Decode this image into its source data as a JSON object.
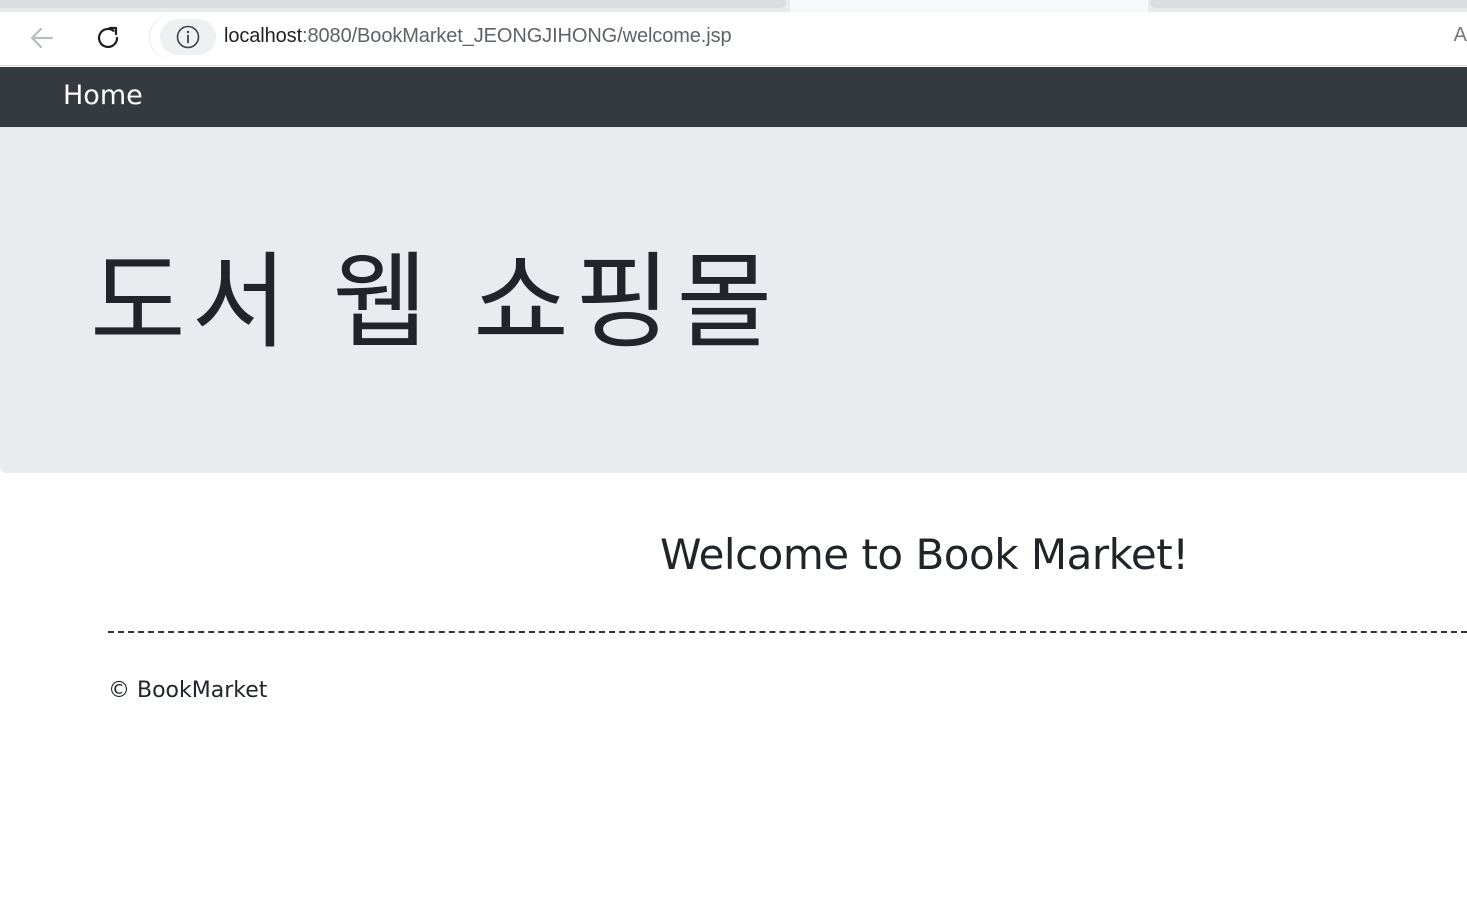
{
  "browser": {
    "url_host": "localhost",
    "url_path": ":8080/BookMarket_JEONGJIHONG/welcome.jsp",
    "cut_off_char": "A"
  },
  "navbar": {
    "brand": "Home"
  },
  "jumbotron": {
    "title": "도서 웹 쇼핑몰"
  },
  "main": {
    "greeting": "Welcome to Book Market!"
  },
  "footer": {
    "text": "© BookMarket"
  },
  "colors": {
    "navbar_bg": "#343a40",
    "jumbotron_bg": "#e9ecef",
    "text": "#212529"
  }
}
